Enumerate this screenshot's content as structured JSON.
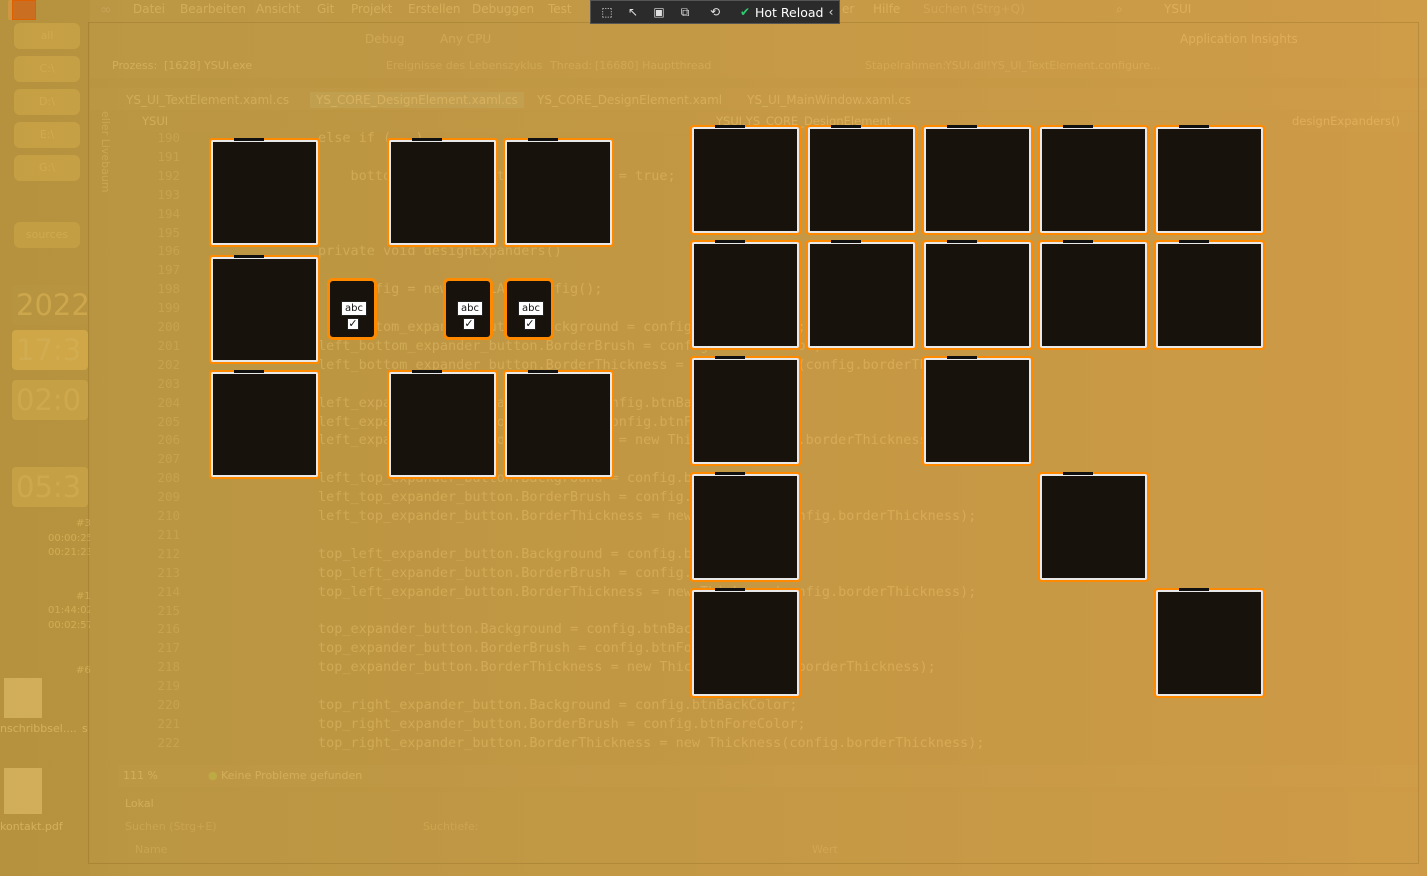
{
  "desktop": {
    "drives": [
      "all",
      "C:\\",
      "D:\\",
      "E:\\",
      "G:\\",
      "sources"
    ],
    "clock_big": "2022",
    "time1": "17:3",
    "time2": "02:0",
    "time3": "05:3",
    "small_lines": [
      "#3",
      "00:00:25",
      "00:21:23",
      "#1",
      "01:44:02",
      "00:02:57",
      "#6"
    ],
    "file1": "nschribbsel....",
    "file1_suffix": "s",
    "file2": "kontakt.pdf"
  },
  "menu": {
    "items": [
      "Datei",
      "Bearbeiten",
      "Ansicht",
      "Git",
      "Projekt",
      "Erstellen",
      "Debuggen",
      "Test"
    ],
    "extra": [
      "er",
      "Hilfe"
    ],
    "search_placeholder": "Suchen (Strg+Q)",
    "solution": "YSUI"
  },
  "hotreload": {
    "label": "Hot Reload"
  },
  "toolbar": {
    "debug": "Debug",
    "cpu": "Any CPU",
    "app_insights": "Application Insights"
  },
  "process": {
    "label": "Prozess:",
    "value": "[1628] YSUI.exe",
    "lifecycle": "Ereignisse des Lebenszyklus",
    "thread": "Thread:",
    "thread_value": "[16680] Hauptthread",
    "stack": "Stapelrahmen:",
    "stack_value": "YSUI.dll!YS_UI_TextElement.configure..."
  },
  "side_label": "Visueller Livebaum",
  "tabs": [
    "YS_UI_TextElement.xaml.cs",
    "YS_CORE_DesignElement.xaml.cs",
    "YS_CORE_DesignElement.xaml",
    "YS_UI_MainWindow.xaml.cs"
  ],
  "breadcrumb": {
    "left": "YSUI",
    "middle": "YSUI.YS_CORE_DesignElement",
    "right": "designExpanders()"
  },
  "editor": {
    "lines": [
      {
        "n": "190",
        "t": "else if (...)"
      },
      {
        "n": "191",
        "t": ""
      },
      {
        "n": "192",
        "t": "    bottom_expander_button.IsEnabled = true;"
      },
      {
        "n": "193",
        "t": ""
      },
      {
        "n": "194",
        "t": ""
      },
      {
        "n": "195",
        "t": ""
      },
      {
        "n": "196",
        "t": "private void designExpanders()"
      },
      {
        "n": "197",
        "t": ""
      },
      {
        "n": "198",
        "t": "    Config = new YS_CLASS_Config();"
      },
      {
        "n": "199",
        "t": ""
      },
      {
        "n": "200",
        "t": "    bottom_expander_button.Background = config.btnBackColor;"
      },
      {
        "n": "201",
        "t": "left_bottom_expander_button.BorderBrush = config.btnForeColor;"
      },
      {
        "n": "202",
        "t": "left_bottom_expander_button.BorderThickness = new Thickness(config.borderThickness);"
      },
      {
        "n": "203",
        "t": ""
      },
      {
        "n": "204",
        "t": "left_expander_button.Background = config.btnBackColor;"
      },
      {
        "n": "205",
        "t": "left_expander_button.BorderBrush = config.btnForeColor;"
      },
      {
        "n": "206",
        "t": "left_expander_button.BorderThickness = new Thickness(config.borderThickness);"
      },
      {
        "n": "207",
        "t": ""
      },
      {
        "n": "208",
        "t": "left_top_expander_button.Background = config.btnBackColor;"
      },
      {
        "n": "209",
        "t": "left_top_expander_button.BorderBrush = config.btnForeColor;"
      },
      {
        "n": "210",
        "t": "left_top_expander_button.BorderThickness = new Thickness(config.borderThickness);"
      },
      {
        "n": "211",
        "t": ""
      },
      {
        "n": "212",
        "t": "top_left_expander_button.Background = config.btnBackColor;"
      },
      {
        "n": "213",
        "t": "top_left_expander_button.BorderBrush = config.btnForeColor;"
      },
      {
        "n": "214",
        "t": "top_left_expander_button.BorderThickness = new Thickness(config.borderThickness);"
      },
      {
        "n": "215",
        "t": ""
      },
      {
        "n": "216",
        "t": "top_expander_button.Background = config.btnBackColor;"
      },
      {
        "n": "217",
        "t": "top_expander_button.BorderBrush = config.btnForeColor;"
      },
      {
        "n": "218",
        "t": "top_expander_button.BorderThickness = new Thickness(config.borderThickness);"
      },
      {
        "n": "219",
        "t": ""
      },
      {
        "n": "220",
        "t": "top_right_expander_button.Background = config.btnBackColor;"
      },
      {
        "n": "221",
        "t": "top_right_expander_button.BorderBrush = config.btnForeColor;"
      },
      {
        "n": "222",
        "t": "top_right_expander_button.BorderThickness = new Thickness(config.borderThickness);"
      }
    ]
  },
  "status": {
    "zoom": "111 %",
    "problems": "Keine Probleme gefunden"
  },
  "bottom": {
    "title": "Lokal",
    "search": "Suchen (Strg+E)",
    "search_depth": "Suchtiefe:",
    "col_name": "Name",
    "col_value": "Wert"
  },
  "mini_widget": {
    "text": "abc",
    "check": "✓"
  },
  "colors": {
    "accent": "#ff8a00",
    "overlay": "#d4a34a",
    "box": "#17120c"
  }
}
